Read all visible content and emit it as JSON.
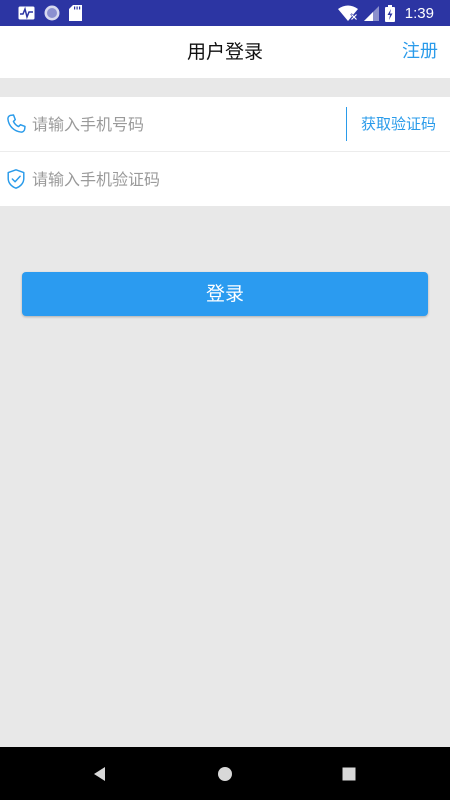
{
  "status_bar": {
    "time": "1:39",
    "left_icons": [
      "activity-icon",
      "circle-icon",
      "sd-card-icon"
    ],
    "right_icons": [
      "wifi-icon",
      "signal-icon",
      "battery-charging-icon"
    ],
    "background": "#2c35a3"
  },
  "app_bar": {
    "title": "用户登录",
    "register_label": "注册"
  },
  "form": {
    "phone_placeholder": "请输入手机号码",
    "phone_value": "",
    "get_code_label": "获取验证码",
    "code_placeholder": "请输入手机验证码",
    "code_value": ""
  },
  "login_label": "登录",
  "nav_bar": {
    "icons": [
      "back-icon",
      "home-icon",
      "recents-icon"
    ]
  },
  "colors": {
    "accent": "#2a9bea",
    "button": "#2b9bf0",
    "page_background": "#e8e8e8"
  }
}
